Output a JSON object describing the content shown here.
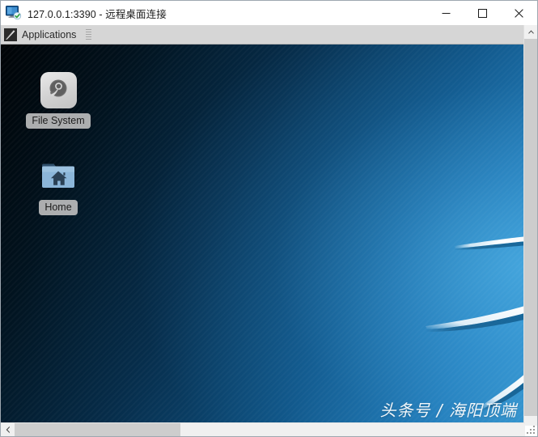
{
  "window": {
    "title": "127.0.0.1:3390 - 远程桌面连接",
    "icon": "remote-desktop-icon",
    "controls": {
      "minimize": "minimize-icon",
      "maximize": "maximize-icon",
      "close": "close-icon"
    }
  },
  "panel": {
    "applications_label": "Applications",
    "applications_icon": "xfce-applications-icon",
    "handle_icon": "panel-drag-handle-icon"
  },
  "desktop": {
    "icons": [
      {
        "label": "File System",
        "icon": "hard-drive-icon"
      },
      {
        "label": "Home",
        "icon": "home-folder-icon"
      }
    ],
    "watermark": "头条号 / 海阳顶端",
    "background": {
      "dark": "#000306",
      "mid": "#0e5486",
      "light": "#3fa5de"
    }
  },
  "scrollbars": {
    "vertical": {
      "up_icon": "chevron-up-icon",
      "down_icon": "chevron-down-icon"
    },
    "horizontal": {
      "left_icon": "chevron-left-icon"
    },
    "resize_grip_icon": "resize-grip-icon"
  },
  "colors": {
    "titlebar_bg": "#ffffff",
    "panel_bg": "#d6d6d6",
    "scroll_track": "#f0f0f0",
    "scroll_thumb": "#cdcdcd",
    "close_hover": "#e81123"
  }
}
